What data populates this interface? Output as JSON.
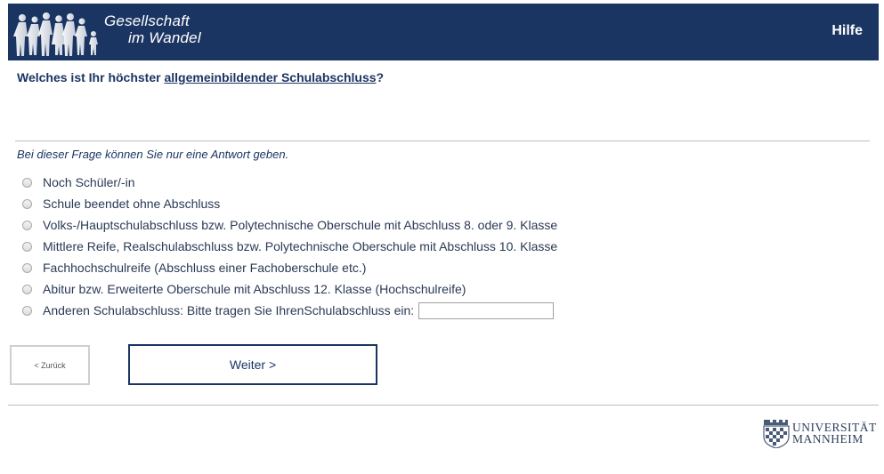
{
  "header": {
    "logo_line1": "Gesellschaft",
    "logo_line2": "im Wandel",
    "help_label": "Hilfe",
    "bg_color": "#1b3563"
  },
  "question": {
    "prefix": "Welches ist Ihr höchster ",
    "link_text": "allgemeinbildender Schulabschluss",
    "suffix": "?"
  },
  "hint": "Bei dieser Frage können Sie nur eine Antwort geben.",
  "options": [
    {
      "label": "Noch Schüler/-in"
    },
    {
      "label": "Schule beendet ohne Abschluss"
    },
    {
      "label": "Volks-/Hauptschulabschluss bzw. Polytechnische Oberschule mit Abschluss 8. oder 9. Klasse"
    },
    {
      "label": "Mittlere Reife, Realschulabschluss bzw. Polytechnische Oberschule mit Abschluss 10. Klasse"
    },
    {
      "label": "Fachhochschulreife (Abschluss einer Fachoberschule etc.)"
    },
    {
      "label": "Abitur bzw. Erweiterte Oberschule mit Abschluss 12. Klasse (Hochschulreife)"
    },
    {
      "label": "Anderen Schulabschluss: Bitte tragen Sie IhrenSchulabschluss ein:",
      "other_value": ""
    }
  ],
  "nav": {
    "back_label": "< Zurück",
    "next_label": "Weiter >"
  },
  "footer": {
    "uni_line1": "UNIVERSITÄT",
    "uni_line2": "MANNHEIM"
  }
}
